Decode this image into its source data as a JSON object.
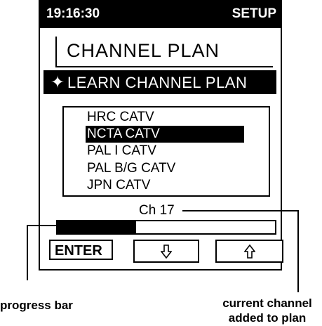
{
  "status": {
    "time": "19:16:30",
    "mode": "SETUP"
  },
  "screen": {
    "title": "CHANNEL PLAN",
    "action": {
      "icon": "four-point-star-icon",
      "glyph": "✦",
      "label": "LEARN CHANNEL PLAN"
    },
    "plans": [
      {
        "label": "HRC CATV",
        "selected": false
      },
      {
        "label": "NCTA CATV",
        "selected": true
      },
      {
        "label": "PAL I CATV",
        "selected": false
      },
      {
        "label": "PAL B/G CATV",
        "selected": false
      },
      {
        "label": "JPN CATV",
        "selected": false
      }
    ],
    "channel": "Ch 17",
    "progress": 0.36,
    "buttons": {
      "enter": "ENTER",
      "down_icon": "down-arrow-icon",
      "up_icon": "up-arrow-icon"
    }
  },
  "captions": {
    "progress": "progress bar",
    "current_line1": "current channel",
    "current_line2": "added to plan"
  }
}
